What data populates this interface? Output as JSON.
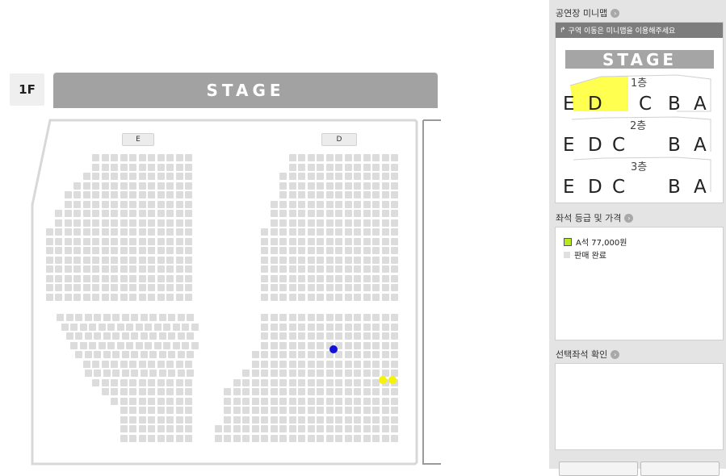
{
  "seatmap": {
    "floor_label": "1F",
    "stage_label": "STAGE",
    "sections": [
      {
        "id": "E",
        "label": "E"
      },
      {
        "id": "D",
        "label": "D"
      }
    ]
  },
  "panel": {
    "minimap_heading": "공연장 미니맵",
    "minimap_hint": "구역 이동은 미니맵을 이용해주세요",
    "minimap_stage": "STAGE",
    "floors": [
      {
        "label": "1층",
        "zones": [
          "E",
          "D",
          "C",
          "B",
          "A"
        ]
      },
      {
        "label": "2층",
        "zones": [
          "E",
          "D",
          "C",
          "B",
          "A"
        ]
      },
      {
        "label": "3층",
        "zones": [
          "E",
          "D",
          "C",
          "B",
          "A"
        ]
      }
    ],
    "grade_heading": "좌석 등급 및 가격",
    "legend": [
      {
        "label": "A석 77,000원",
        "color": "#b6e91e"
      },
      {
        "label": "판매 완료",
        "color": "#e0e0e0"
      }
    ],
    "selected_heading": "선택좌석 확인"
  },
  "colors": {
    "stage": "#a2a2a2",
    "seat_sold": "#dcdcdc",
    "seat_available": "#f4f40a",
    "seat_selected": "#1010d8",
    "minimap_highlight": "#ffff50"
  },
  "seats": {
    "available_count": 2,
    "selected_count": 1
  }
}
